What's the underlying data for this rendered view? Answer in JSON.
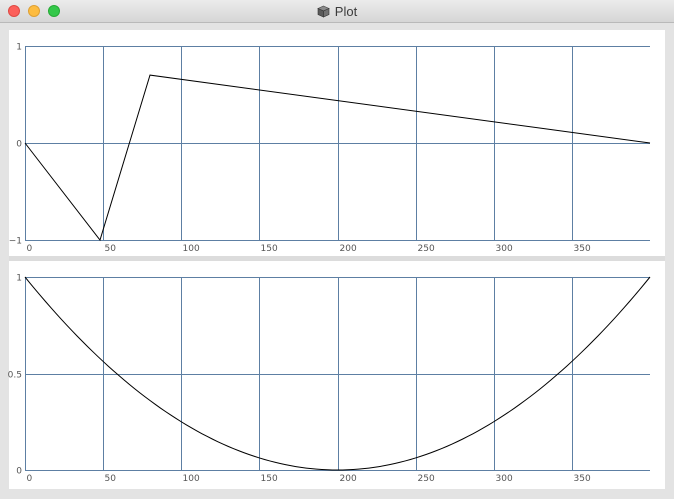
{
  "window": {
    "title": "Plot",
    "app_icon": "cube-icon"
  },
  "colors": {
    "grid": "#5d7fa3",
    "line": "#000000",
    "tick_text": "#555555"
  },
  "chart_data": [
    {
      "type": "line",
      "title": "",
      "xlabel": "",
      "ylabel": "",
      "xlim": [
        0,
        400
      ],
      "ylim": [
        -1,
        1
      ],
      "grid": true,
      "x_ticks": [
        "0",
        "50",
        "100",
        "150",
        "200",
        "250",
        "300",
        "350"
      ],
      "y_ticks": [
        "−1",
        "0",
        "1"
      ],
      "x_tick_values": [
        0,
        50,
        100,
        150,
        200,
        250,
        300,
        350
      ],
      "y_tick_values": [
        -1,
        0,
        1
      ],
      "series": [
        {
          "x": [
            0,
            48,
            80,
            400
          ],
          "y": [
            0,
            -1,
            0.7,
            0
          ]
        }
      ]
    },
    {
      "type": "line",
      "title": "",
      "xlabel": "",
      "ylabel": "",
      "xlim": [
        0,
        400
      ],
      "ylim": [
        0,
        1
      ],
      "grid": true,
      "x_ticks": [
        "0",
        "50",
        "100",
        "150",
        "200",
        "250",
        "300",
        "350"
      ],
      "y_ticks": [
        "0",
        "0.5",
        "1"
      ],
      "x_tick_values": [
        0,
        50,
        100,
        150,
        200,
        250,
        300,
        350
      ],
      "y_tick_values": [
        0,
        0.5,
        1
      ],
      "series": [
        {
          "curve": "parabola",
          "vertex": [
            200,
            0
          ],
          "ends": [
            [
              0,
              1
            ],
            [
              400,
              1
            ]
          ]
        }
      ]
    }
  ]
}
